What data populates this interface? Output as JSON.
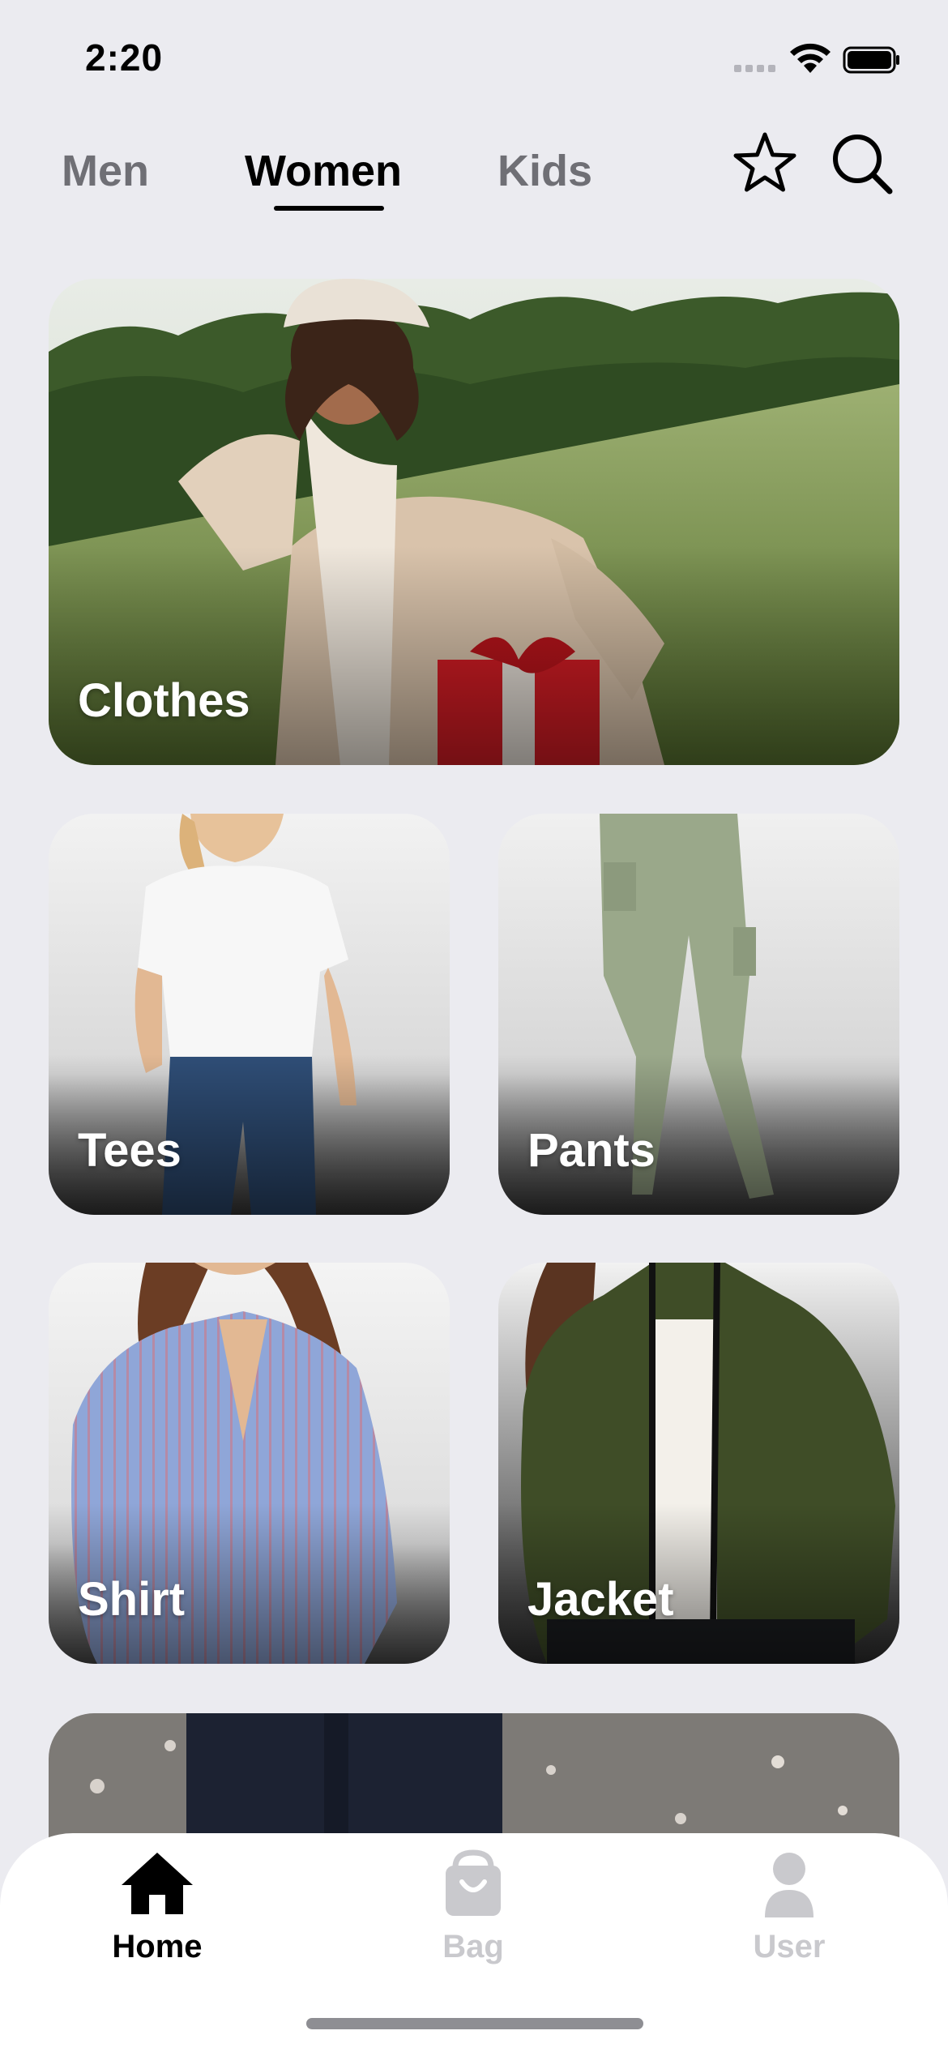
{
  "status_bar": {
    "time": "2:20"
  },
  "tabs": [
    {
      "label": "Men",
      "active": false
    },
    {
      "label": "Women",
      "active": true
    },
    {
      "label": "Kids",
      "active": false
    }
  ],
  "header_icons": [
    "star-icon",
    "search-icon"
  ],
  "cards": {
    "clothes": "Clothes",
    "tees": "Tees",
    "pants": "Pants",
    "shirt": "Shirt",
    "jacket": "Jacket"
  },
  "bottom_nav": {
    "items": [
      {
        "label": "Home",
        "icon": "home-icon",
        "active": true
      },
      {
        "label": "Bag",
        "icon": "bag-icon",
        "active": false
      },
      {
        "label": "User",
        "icon": "user-icon",
        "active": false
      }
    ]
  },
  "colors": {
    "background": "#ebebf0",
    "active": "#000000",
    "inactive": "#c9c9cd",
    "tab_inactive": "#6f6f75"
  }
}
